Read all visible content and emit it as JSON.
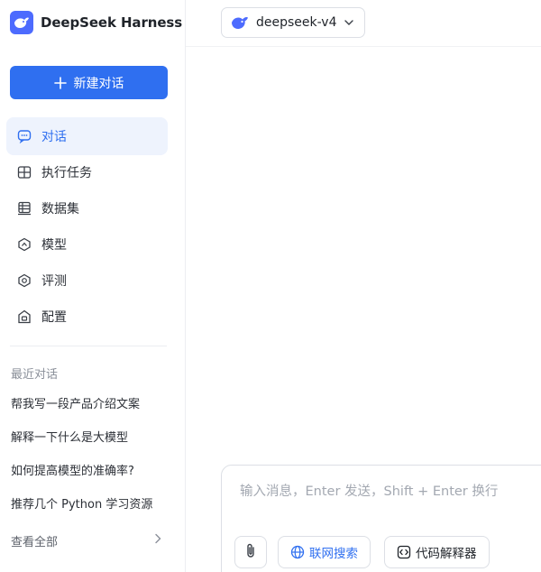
{
  "brand": {
    "title": "DeepSeek Harness",
    "accent": "#4d6bfe"
  },
  "sidebar": {
    "new_chat_label": "新建对话",
    "nav": [
      {
        "label": "对话",
        "icon": "chat-bubble-icon",
        "active": true
      },
      {
        "label": "执行任务",
        "icon": "task-grid-icon",
        "active": false
      },
      {
        "label": "数据集",
        "icon": "dataset-icon",
        "active": false
      },
      {
        "label": "模型",
        "icon": "model-cube-icon",
        "active": false
      },
      {
        "label": "评测",
        "icon": "evaluation-icon",
        "active": false
      },
      {
        "label": "配置",
        "icon": "settings-icon",
        "active": false
      }
    ],
    "recent_label": "最近对话",
    "recent": [
      "帮我写一段产品介绍文案",
      "解释一下什么是大模型",
      "如何提高模型的准确率?",
      "推荐几个 Python 学习资源"
    ],
    "view_all_label": "查看全部"
  },
  "header": {
    "model_name": "deepseek-v4"
  },
  "composer": {
    "placeholder": "输入消息，Enter 发送，Shift + Enter 换行",
    "web_search_label": "联网搜索",
    "code_interpreter_label": "代码解释器"
  },
  "colors": {
    "primary": "#2f6ff0",
    "active_bg": "#eef3fd",
    "border": "#dcdfe5"
  }
}
